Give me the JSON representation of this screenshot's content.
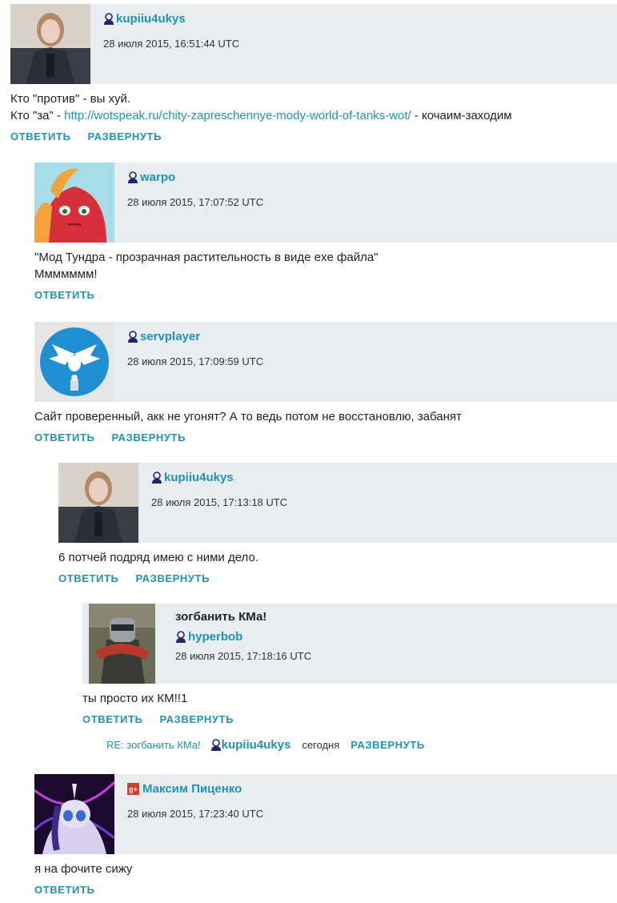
{
  "comments": [
    {
      "username": "kupiiu4ukys",
      "date": "28 июля 2015, 16:51:44 UTC",
      "line1": "Кто \"против\" - вы хуй.",
      "line2_prefix": "Кто \"за\" - ",
      "line2_link": "http://wotspeak.ru/chity-zapreschennye-mody-world-of-tanks-wot/",
      "line2_suffix": " - кочаим-заходим",
      "reply": "ОТВЕТИТЬ",
      "expand": "РАЗВЕРНУТЬ"
    },
    {
      "username": "warpo",
      "date": "28 июля 2015, 17:07:52 UTC",
      "line1": "\"Мод Тундра - прозрачная растительность в виде exe файла\"",
      "line2": "Ммммммм!",
      "reply": "ОТВЕТИТЬ"
    },
    {
      "username": "servplayer",
      "date": "28 июля 2015, 17:09:59 UTC",
      "line1": "Сайт проверенный, акк не угонят? А то ведь потом не восстановлю, забанят",
      "reply": "ОТВЕТИТЬ",
      "expand": "РАЗВЕРНУТЬ"
    },
    {
      "username": "kupiiu4ukys",
      "date": "28 июля 2015, 17:13:18 UTC",
      "line1": "6 потчей подряд имею с ними дело.",
      "reply": "ОТВЕТИТЬ",
      "expand": "РАЗВЕРНУТЬ"
    },
    {
      "topic": "зогбанить КМа!",
      "username": "hyperbob",
      "date": "28 июля 2015, 17:18:16 UTC",
      "line1": "ты просто их КМ!!1",
      "reply": "ОТВЕТИТЬ",
      "expand": "РАЗВЕРНУТЬ"
    },
    {
      "username": "Максим Пиценко",
      "date": "28 июля 2015, 17:23:40 UTC",
      "line1": "я на фочите сижу",
      "reply": "ОТВЕТИТЬ"
    }
  ],
  "collapsed_reply": {
    "title": "RE: зогбанить КМа!",
    "username": "kupiiu4ukys",
    "time": "сегодня",
    "expand": "РАЗВЕРНУТЬ"
  },
  "icons": {
    "user": "user-icon",
    "gplus": "google-plus-icon",
    "gplus_text": "g+"
  },
  "colors": {
    "link": "#1f93b7",
    "header_bg": "#e9edf0",
    "gplus": "#d63c2a"
  }
}
